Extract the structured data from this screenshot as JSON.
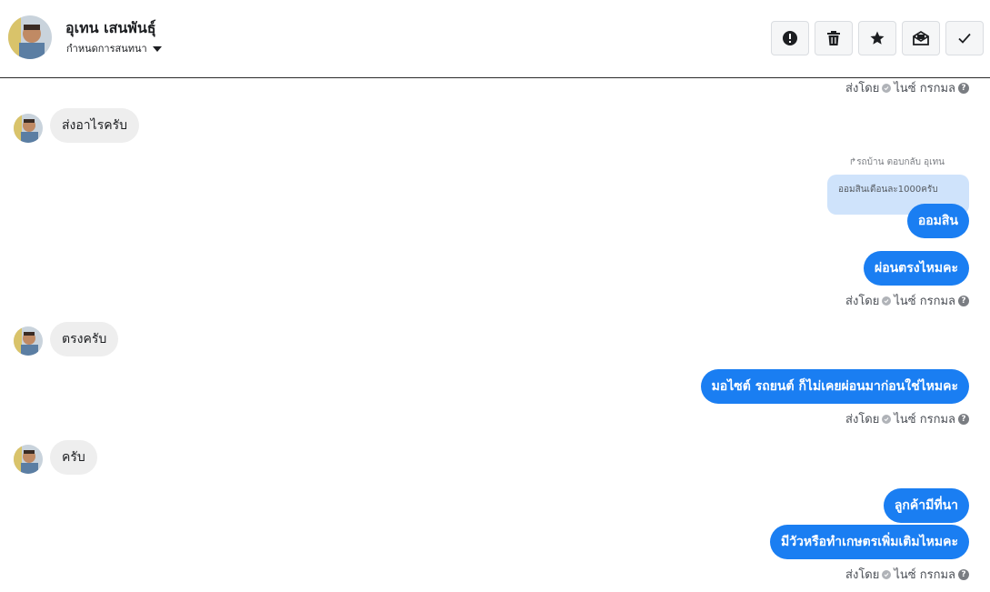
{
  "header": {
    "name": "อุเทน เสนพันธุ์",
    "assign_label": "กำหนดการสนทนา",
    "toolbar": [
      {
        "icon": "alert-circle-icon",
        "label": "report"
      },
      {
        "icon": "trash-icon",
        "label": "delete"
      },
      {
        "icon": "star-icon",
        "label": "star"
      },
      {
        "icon": "mail-icon",
        "label": "mark unread"
      },
      {
        "icon": "check-icon",
        "label": "done"
      }
    ]
  },
  "sent_meta": {
    "prefix": "ส่งโดย",
    "sender": "ไนซ์ กรกมล",
    "help": "?"
  },
  "messages": {
    "in_1": "ส่งอาไรครับ",
    "reply_label": "รถบ้าน ตอบกลับ อุเทน",
    "quoted": "ออมสินเดือนละ1000ครับ",
    "out_1": "ออมสิน",
    "out_2": "ผ่อนตรงไหมคะ",
    "in_2": "ตรงครับ",
    "out_3": "มอไซต์ รถยนต์ ก็ไม่เคยผ่อนมาก่อนใช่ไหมคะ",
    "in_3": "ครับ",
    "out_4": "ลูกค้ามีที่นา",
    "out_5": "มีวัวหรือทำเกษตรเพิ่มเติมไหมคะ"
  },
  "colors": {
    "outgoing_bubble": "#1a7ef2",
    "incoming_bubble": "#eeeeee",
    "quoted_bubble": "#cfe3fb"
  }
}
